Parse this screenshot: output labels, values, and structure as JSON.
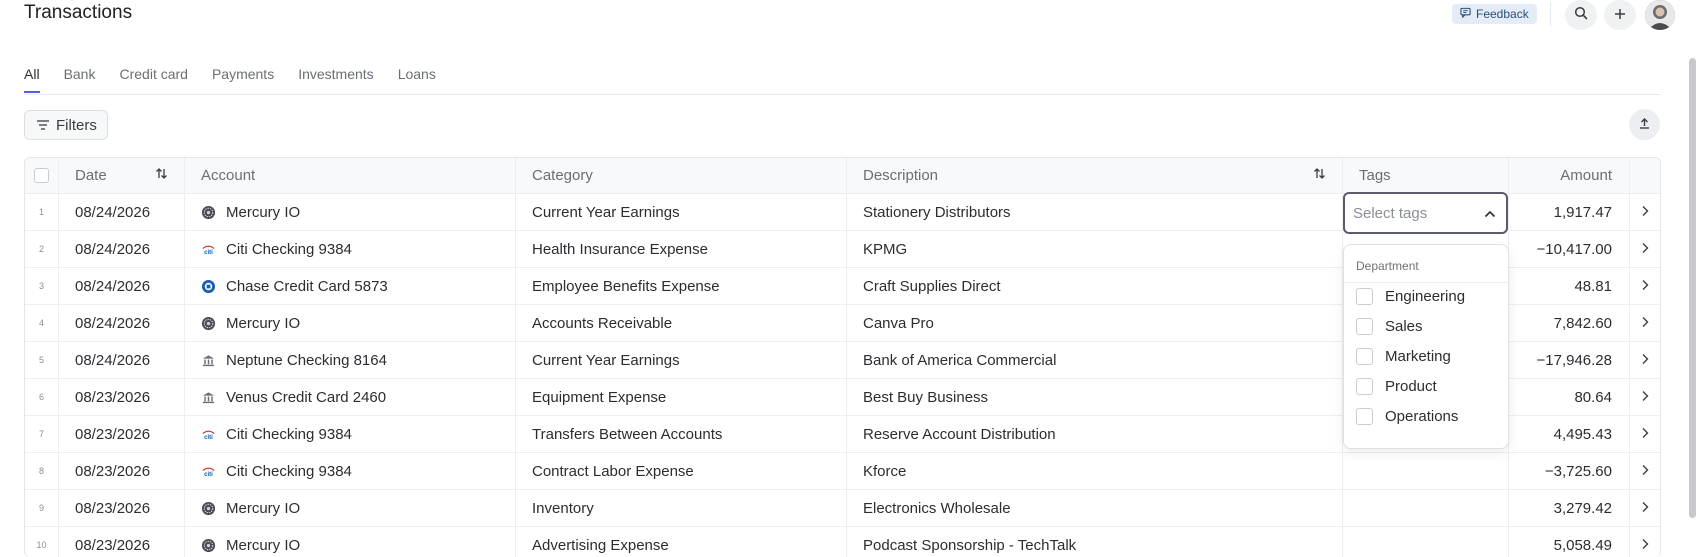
{
  "page": {
    "title": "Transactions"
  },
  "topbar": {
    "feedback_label": "Feedback"
  },
  "tabs": [
    {
      "label": "All",
      "active": true
    },
    {
      "label": "Bank",
      "active": false
    },
    {
      "label": "Credit card",
      "active": false
    },
    {
      "label": "Payments",
      "active": false
    },
    {
      "label": "Investments",
      "active": false
    },
    {
      "label": "Loans",
      "active": false
    }
  ],
  "toolbar": {
    "filters_label": "Filters"
  },
  "table": {
    "headers": {
      "date": "Date",
      "account": "Account",
      "category": "Category",
      "description": "Description",
      "tags": "Tags",
      "amount": "Amount"
    },
    "rows": [
      {
        "idx": "1",
        "date": "08/24/2026",
        "icon": "mercury-icon",
        "account": "Mercury IO",
        "category": "Current Year Earnings",
        "description": "Stationery Distributors",
        "amount": "1,917.47"
      },
      {
        "idx": "2",
        "date": "08/24/2026",
        "icon": "citi-icon",
        "account": "Citi Checking 9384",
        "category": "Health Insurance Expense",
        "description": "KPMG",
        "amount": "−10,417.00"
      },
      {
        "idx": "3",
        "date": "08/24/2026",
        "icon": "chase-icon",
        "account": "Chase Credit Card 5873",
        "category": "Employee Benefits Expense",
        "description": "Craft Supplies Direct",
        "amount": "48.81"
      },
      {
        "idx": "4",
        "date": "08/24/2026",
        "icon": "mercury-icon",
        "account": "Mercury IO",
        "category": "Accounts Receivable",
        "description": "Canva Pro",
        "amount": "7,842.60"
      },
      {
        "idx": "5",
        "date": "08/24/2026",
        "icon": "bank-icon",
        "account": "Neptune Checking 8164",
        "category": "Current Year Earnings",
        "description": "Bank of America Commercial",
        "amount": "−17,946.28"
      },
      {
        "idx": "6",
        "date": "08/23/2026",
        "icon": "bank-icon",
        "account": "Venus Credit Card 2460",
        "category": "Equipment Expense",
        "description": "Best Buy Business",
        "amount": "80.64"
      },
      {
        "idx": "7",
        "date": "08/23/2026",
        "icon": "citi-icon",
        "account": "Citi Checking 9384",
        "category": "Transfers Between Accounts",
        "description": "Reserve Account Distribution",
        "amount": "4,495.43"
      },
      {
        "idx": "8",
        "date": "08/23/2026",
        "icon": "citi-icon",
        "account": "Citi Checking 9384",
        "category": "Contract Labor Expense",
        "description": "Kforce",
        "amount": "−3,725.60"
      },
      {
        "idx": "9",
        "date": "08/23/2026",
        "icon": "mercury-icon",
        "account": "Mercury IO",
        "category": "Inventory",
        "description": "Electronics Wholesale",
        "amount": "3,279.42"
      },
      {
        "idx": "10",
        "date": "08/23/2026",
        "icon": "mercury-icon",
        "account": "Mercury IO",
        "category": "Advertising Expense",
        "description": "Podcast Sponsorship - TechTalk",
        "amount": "5,058.49"
      }
    ]
  },
  "tag_select": {
    "placeholder": "Select tags",
    "group_label": "Department",
    "options": [
      "Engineering",
      "Sales",
      "Marketing",
      "Product",
      "Operations"
    ]
  },
  "colors": {
    "accent": "#5b5ed6",
    "feedback_bg": "#e4edf7",
    "chase_blue": "#1a5fb4",
    "citi_blue": "#0b5fb0"
  }
}
